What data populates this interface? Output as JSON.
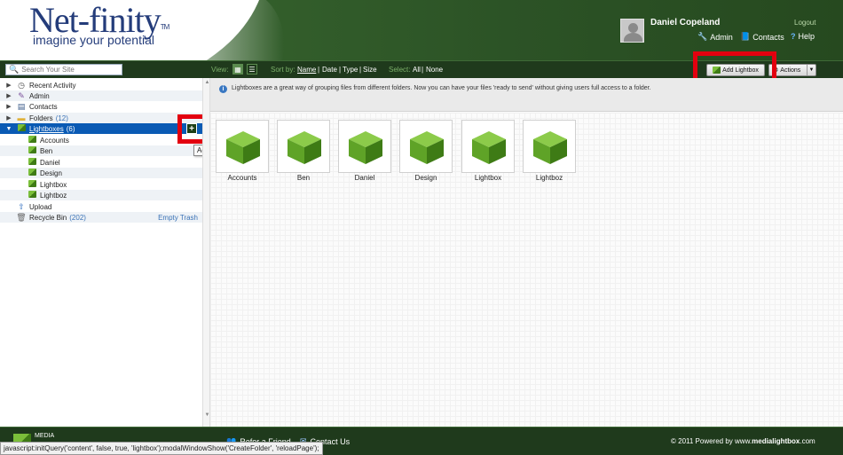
{
  "brand": {
    "name": "Net-finity",
    "tm": "TM",
    "tagline": "imagine your potential"
  },
  "user": {
    "name": "Daniel Copeland",
    "logout": "Logout"
  },
  "header_links": [
    {
      "icon": "wrench-icon",
      "label": "Admin"
    },
    {
      "icon": "contacts-icon",
      "label": "Contacts"
    },
    {
      "icon": "help-icon",
      "label": "Help"
    }
  ],
  "toolbar": {
    "search_placeholder": "Search Your Site",
    "view_label": "View:",
    "sort_label": "Sort by:",
    "sort_options": [
      "Name",
      "Date",
      "Type",
      "Size"
    ],
    "select_label": "Select:",
    "select_options": [
      "All",
      "None"
    ],
    "add_lightbox": "Add Lightbox",
    "actions": "Actions"
  },
  "sidebar": {
    "items": [
      {
        "label": "Recent Activity",
        "icon": "recent-activity-icon"
      },
      {
        "label": "Admin",
        "icon": "wrench-icon"
      },
      {
        "label": "Contacts",
        "icon": "contacts-icon"
      },
      {
        "label": "Folders",
        "count": "(12)",
        "icon": "folder-icon"
      },
      {
        "label": "Lightboxes",
        "count": "(6)",
        "icon": "lightbox-icon"
      },
      {
        "label": "Accounts"
      },
      {
        "label": "Ben"
      },
      {
        "label": "Daniel"
      },
      {
        "label": "Design"
      },
      {
        "label": "Lightbox"
      },
      {
        "label": "Lightboz"
      },
      {
        "label": "Upload",
        "icon": "upload-icon"
      },
      {
        "label": "Recycle Bin",
        "count": "(202)",
        "icon": "trash-icon"
      }
    ],
    "empty_trash": "Empty Trash",
    "plus": "+",
    "tooltip": "Add Lightbox"
  },
  "main": {
    "info": "Lightboxes are a great way of grouping files from different folders. Now you can have your files 'ready to send' without giving users full access to a folder.",
    "tiles": [
      "Accounts",
      "Ben",
      "Daniel",
      "Design",
      "Lightbox",
      "Lightboz"
    ]
  },
  "footer": {
    "logo_text": "MEDIA",
    "refer": "Refer a Friend",
    "contact": "Contact Us",
    "copyright_prefix": "© 2011 Powered by www.",
    "copyright_bold": "medialightbox",
    "copyright_suffix": ".com"
  },
  "statusbar": "javascript:initQuery('content', false, true, 'lightbox');modalWindowShow('CreateFolder', 'reloadPage');",
  "colors": {
    "header_green": "#2f5428",
    "toolbar_green": "#1f3a1c",
    "highlight_red": "#e3000f",
    "selection_blue": "#0a5ab4",
    "cube_green": "#5fa327"
  }
}
